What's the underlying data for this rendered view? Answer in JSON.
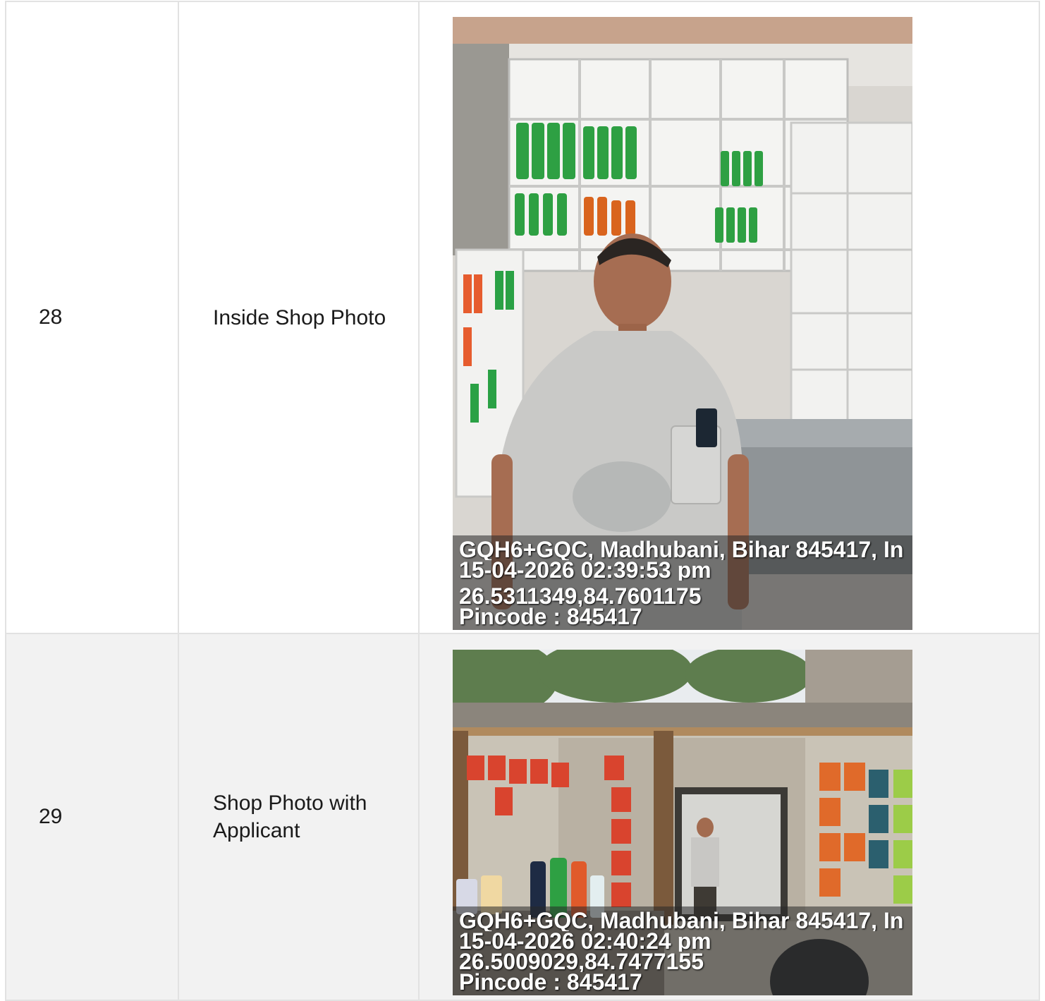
{
  "rows": [
    {
      "sno": "28",
      "label": "Inside Shop Photo",
      "photo": {
        "icon": "shopkeeper-inside-shop-photo",
        "address": "GQH6+GQC, Madhubani, Bihar 845417, In",
        "datetime": "15-04-2026 02:39:53 pm",
        "coords": "26.5311349,84.7601175",
        "pincode": "Pincode : 845417"
      }
    },
    {
      "sno": "29",
      "label": "Shop Photo with Applicant",
      "photo": {
        "icon": "shopfront-with-applicant-photo",
        "address": "GQH6+GQC, Madhubani, Bihar 845417, In",
        "datetime": "15-04-2026 02:40:24 pm",
        "coords": "26.5009029,84.7477155",
        "pincode": "Pincode : 845417"
      }
    }
  ]
}
